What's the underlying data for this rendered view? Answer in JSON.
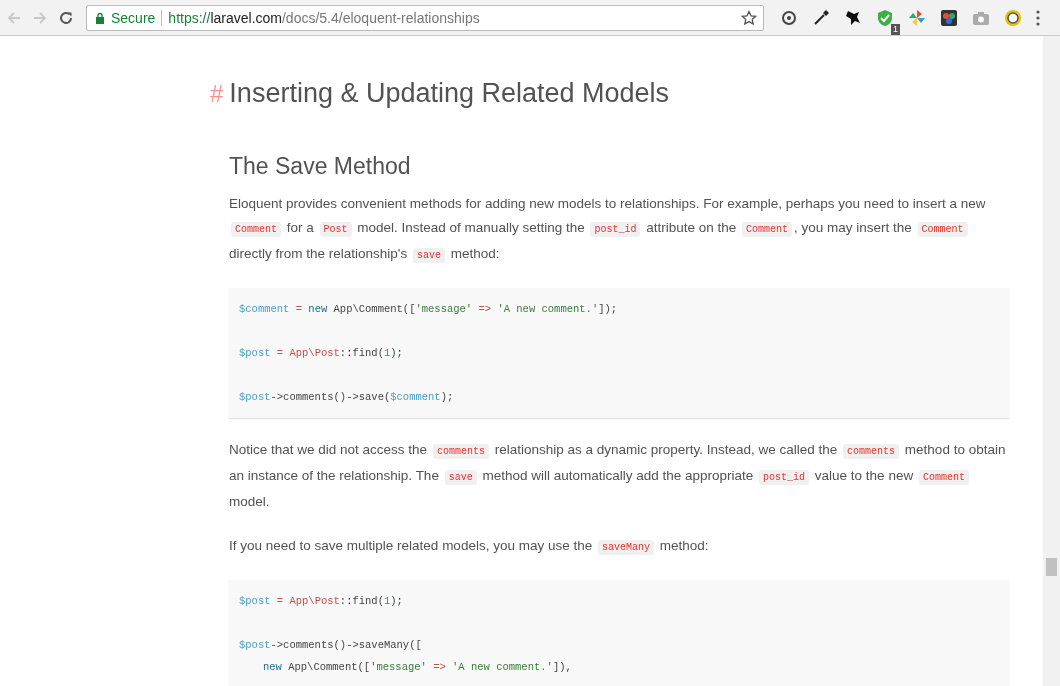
{
  "browser": {
    "secure_label": "Secure",
    "url": {
      "scheme": "https://",
      "host": "laravel.com",
      "path": "/docs/5.4/eloquent-relationships"
    },
    "extension_badge": "1"
  },
  "page": {
    "anchor": "#",
    "title": "Inserting & Updating Related Models",
    "sections": [
      {
        "heading": "The Save Method",
        "blocks": [
          {
            "kind": "paragraph",
            "parts": [
              {
                "kind": "text",
                "text": "Eloquent provides convenient methods for adding new models to relationships. For example, perhaps you need to insert a new "
              },
              {
                "kind": "code",
                "text": "Comment"
              },
              {
                "kind": "text",
                "text": " for a "
              },
              {
                "kind": "code",
                "text": "Post"
              },
              {
                "kind": "text",
                "text": " model. Instead of manually setting the "
              },
              {
                "kind": "code",
                "text": "post_id"
              },
              {
                "kind": "text",
                "text": " attribute on the "
              },
              {
                "kind": "code",
                "text": "Comment"
              },
              {
                "kind": "text",
                "text": ", you may insert the "
              },
              {
                "kind": "code",
                "text": "Comment"
              },
              {
                "kind": "text",
                "text": " directly from the relationship's "
              },
              {
                "kind": "code",
                "text": "save"
              },
              {
                "kind": "text",
                "text": " method:"
              }
            ]
          },
          {
            "kind": "code",
            "lines": [
              {
                "spaced": false,
                "indented": false,
                "tokens": [
                  {
                    "kind": "var",
                    "text": "$comment"
                  },
                  {
                    "kind": "op",
                    "text": " = "
                  },
                  {
                    "kind": "kw",
                    "text": "new"
                  },
                  {
                    "kind": "plain",
                    "text": " App\\Comment(["
                  },
                  {
                    "kind": "str",
                    "text": "'message'"
                  },
                  {
                    "kind": "op",
                    "text": " => "
                  },
                  {
                    "kind": "str",
                    "text": "'A new comment.'"
                  },
                  {
                    "kind": "plain",
                    "text": "]);"
                  }
                ]
              },
              {
                "spaced": true,
                "indented": false,
                "tokens": [
                  {
                    "kind": "var",
                    "text": "$post"
                  },
                  {
                    "kind": "op",
                    "text": " = "
                  },
                  {
                    "kind": "cls",
                    "text": "App\\Post"
                  },
                  {
                    "kind": "plain",
                    "text": "::find("
                  },
                  {
                    "kind": "num",
                    "text": "1"
                  },
                  {
                    "kind": "plain",
                    "text": ");"
                  }
                ]
              },
              {
                "spaced": true,
                "indented": false,
                "tokens": [
                  {
                    "kind": "var",
                    "text": "$post"
                  },
                  {
                    "kind": "plain",
                    "text": "->comments()->save("
                  },
                  {
                    "kind": "var",
                    "text": "$comment"
                  },
                  {
                    "kind": "plain",
                    "text": ");"
                  }
                ]
              }
            ]
          },
          {
            "kind": "paragraph",
            "parts": [
              {
                "kind": "text",
                "text": "Notice that we did not access the "
              },
              {
                "kind": "code",
                "text": "comments"
              },
              {
                "kind": "text",
                "text": " relationship as a dynamic property. Instead, we called the "
              },
              {
                "kind": "code",
                "text": "comments"
              },
              {
                "kind": "text",
                "text": " method to obtain an instance of the relationship. The "
              },
              {
                "kind": "code",
                "text": "save"
              },
              {
                "kind": "text",
                "text": " method will automatically add the appropriate "
              },
              {
                "kind": "code",
                "text": "post_id"
              },
              {
                "kind": "text",
                "text": " value to the new "
              },
              {
                "kind": "code",
                "text": "Comment"
              },
              {
                "kind": "text",
                "text": " model."
              }
            ]
          },
          {
            "kind": "paragraph",
            "parts": [
              {
                "kind": "text",
                "text": "If you need to save multiple related models, you may use the "
              },
              {
                "kind": "code",
                "text": "saveMany"
              },
              {
                "kind": "text",
                "text": " method:"
              }
            ]
          },
          {
            "kind": "code",
            "lines": [
              {
                "spaced": false,
                "indented": false,
                "tokens": [
                  {
                    "kind": "var",
                    "text": "$post"
                  },
                  {
                    "kind": "op",
                    "text": " = "
                  },
                  {
                    "kind": "cls",
                    "text": "App\\Post"
                  },
                  {
                    "kind": "plain",
                    "text": "::find("
                  },
                  {
                    "kind": "num",
                    "text": "1"
                  },
                  {
                    "kind": "plain",
                    "text": ");"
                  }
                ]
              },
              {
                "spaced": true,
                "indented": false,
                "tokens": [
                  {
                    "kind": "var",
                    "text": "$post"
                  },
                  {
                    "kind": "plain",
                    "text": "->comments()->saveMany(["
                  }
                ]
              },
              {
                "spaced": false,
                "indented": true,
                "tokens": [
                  {
                    "kind": "kw",
                    "text": "new"
                  },
                  {
                    "kind": "plain",
                    "text": " App\\Comment(["
                  },
                  {
                    "kind": "str",
                    "text": "'message'"
                  },
                  {
                    "kind": "op",
                    "text": " => "
                  },
                  {
                    "kind": "str",
                    "text": "'A new comment.'"
                  },
                  {
                    "kind": "plain",
                    "text": "]),"
                  }
                ]
              }
            ]
          }
        ]
      }
    ]
  }
}
